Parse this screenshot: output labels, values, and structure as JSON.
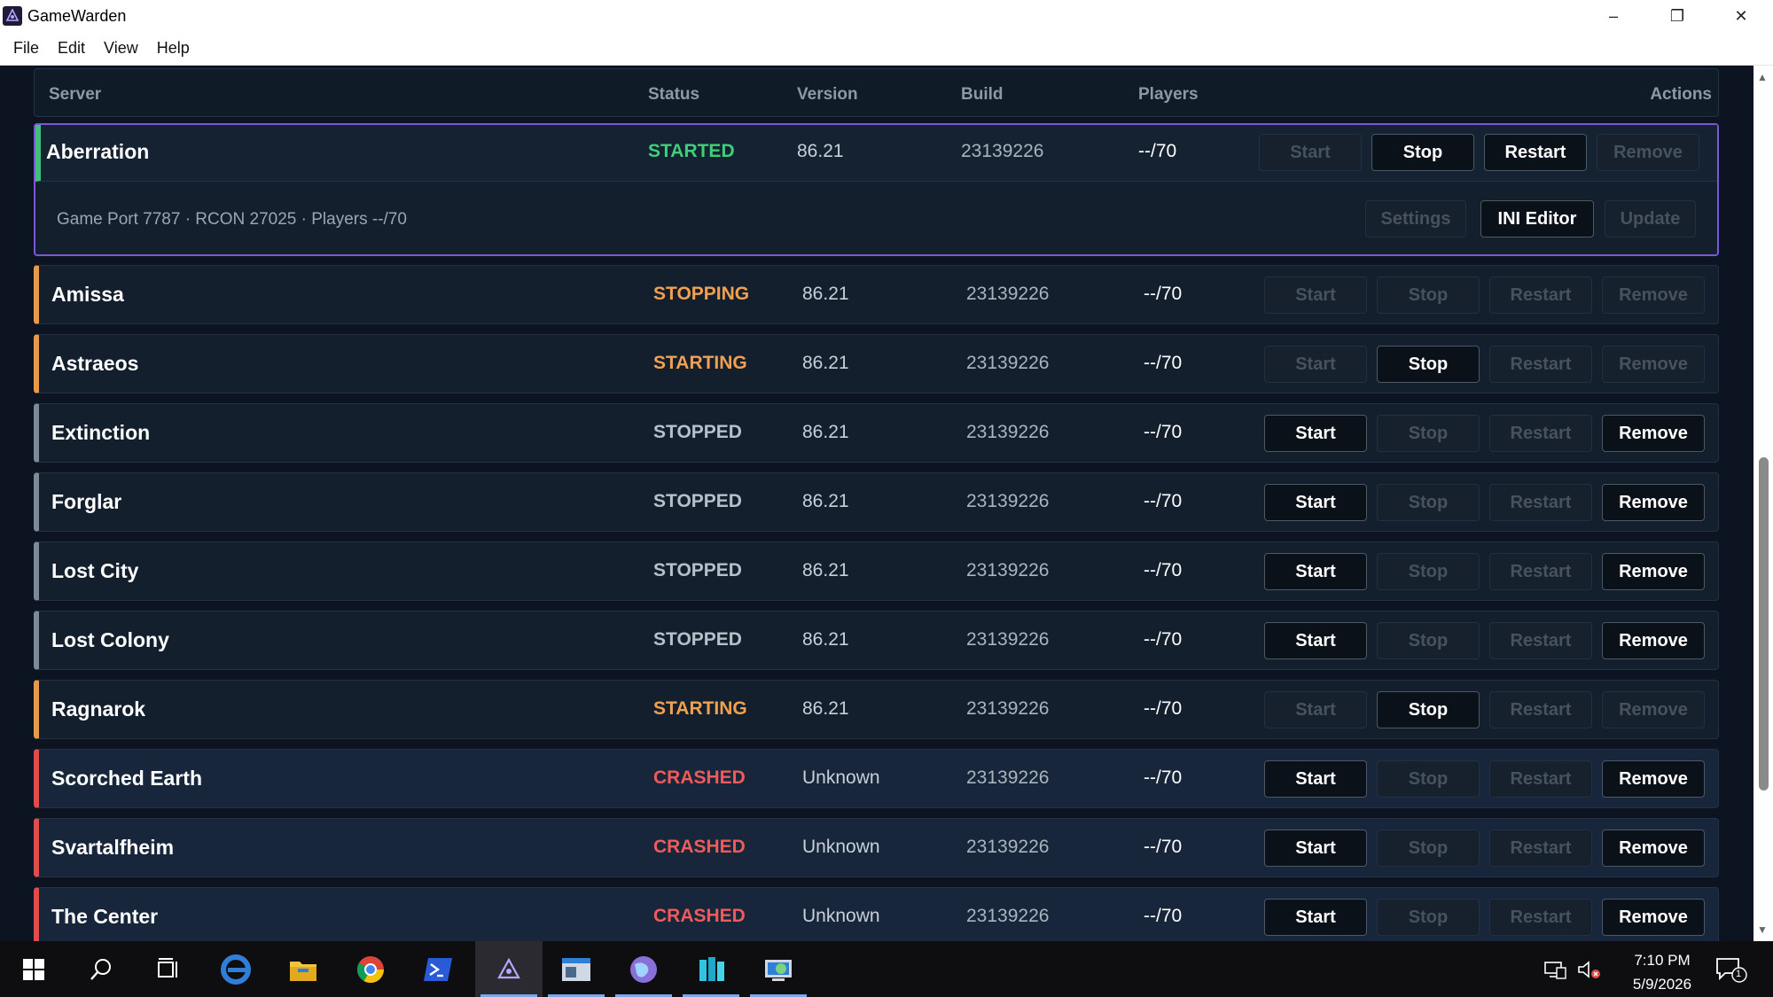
{
  "window": {
    "title": "GameWarden",
    "minimize": "–",
    "maximize": "❐",
    "close": "✕"
  },
  "menu": [
    "File",
    "Edit",
    "View",
    "Help"
  ],
  "columns": {
    "server": "Server",
    "status": "Status",
    "version": "Version",
    "build": "Build",
    "players": "Players",
    "actions": "Actions"
  },
  "status_colors": {
    "STARTED": "#3ecf7a",
    "STOPPING": "#f0a050",
    "STARTING": "#f0a050",
    "STOPPED": "#b6c0ca",
    "CRASHED": "#ef5a5a"
  },
  "stripe_colors": {
    "STARTED": "#3ec07a",
    "STOPPING": "#e89a4a",
    "STARTING": "#e89a4a",
    "STOPPED": "#7e8a96",
    "CRASHED": "#e04b4b"
  },
  "button_labels": {
    "start": "Start",
    "stop": "Stop",
    "restart": "Restart",
    "remove": "Remove"
  },
  "servers": [
    {
      "name": "Aberration",
      "status": "STARTED",
      "version": "86.21",
      "build": "23139226",
      "players": "--/70",
      "start": false,
      "stop": true,
      "restart": true,
      "remove": false
    },
    {
      "name": "Amissa",
      "status": "STOPPING",
      "version": "86.21",
      "build": "23139226",
      "players": "--/70",
      "start": false,
      "stop": false,
      "restart": false,
      "remove": false
    },
    {
      "name": "Astraeos",
      "status": "STARTING",
      "version": "86.21",
      "build": "23139226",
      "players": "--/70",
      "start": false,
      "stop": true,
      "restart": false,
      "remove": false
    },
    {
      "name": "Extinction",
      "status": "STOPPED",
      "version": "86.21",
      "build": "23139226",
      "players": "--/70",
      "start": true,
      "stop": false,
      "restart": false,
      "remove": true
    },
    {
      "name": "Forglar",
      "status": "STOPPED",
      "version": "86.21",
      "build": "23139226",
      "players": "--/70",
      "start": true,
      "stop": false,
      "restart": false,
      "remove": true
    },
    {
      "name": "Lost City",
      "status": "STOPPED",
      "version": "86.21",
      "build": "23139226",
      "players": "--/70",
      "start": true,
      "stop": false,
      "restart": false,
      "remove": true
    },
    {
      "name": "Lost Colony",
      "status": "STOPPED",
      "version": "86.21",
      "build": "23139226",
      "players": "--/70",
      "start": true,
      "stop": false,
      "restart": false,
      "remove": true
    },
    {
      "name": "Ragnarok",
      "status": "STARTING",
      "version": "86.21",
      "build": "23139226",
      "players": "--/70",
      "start": false,
      "stop": true,
      "restart": false,
      "remove": false
    },
    {
      "name": "Scorched Earth",
      "status": "CRASHED",
      "version": "Unknown",
      "build": "23139226",
      "players": "--/70",
      "start": true,
      "stop": false,
      "restart": false,
      "remove": true
    },
    {
      "name": "Svartalfheim",
      "status": "CRASHED",
      "version": "Unknown",
      "build": "23139226",
      "players": "--/70",
      "start": true,
      "stop": false,
      "restart": false,
      "remove": true
    },
    {
      "name": "The Center",
      "status": "CRASHED",
      "version": "Unknown",
      "build": "23139226",
      "players": "--/70",
      "start": true,
      "stop": false,
      "restart": false,
      "remove": true
    }
  ],
  "expanded": {
    "detail": "Game Port 7787 · RCON 27025 · Players --/70",
    "settings": "Settings",
    "settings_enabled": false,
    "ini_editor": "INI Editor",
    "ini_enabled": true,
    "update": "Update",
    "update_enabled": false
  },
  "taskbar": {
    "icons": [
      "start-icon",
      "search-icon",
      "task-view-icon",
      "edge-icon",
      "file-explorer-icon",
      "chrome-icon",
      "powershell-icon",
      "gamewarden-icon",
      "server-manager-icon",
      "browser-globe-icon",
      "storage-icon",
      "network-tool-icon"
    ],
    "time": "7:10 PM",
    "date": "5/9/2026",
    "notification_count": "1"
  }
}
